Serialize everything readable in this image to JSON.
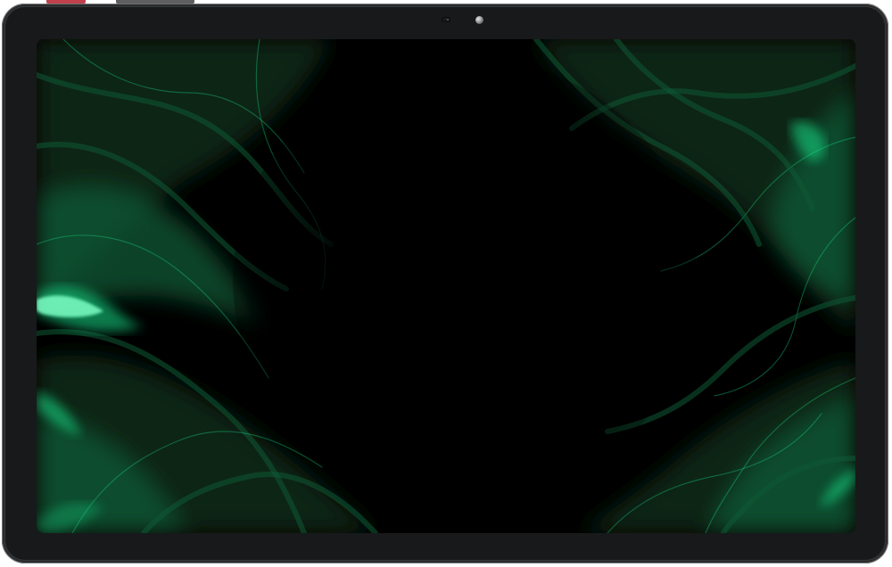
{
  "device": {
    "body_color": "#2a2b2d",
    "bezel_color": "#18191a",
    "power_button_color": "#c0404c",
    "volume_button_color": "#5e5e60"
  },
  "wallpaper": {
    "style": "abstract fluid marble waves",
    "base_color": "#000000",
    "deep_green": "#0a2a19",
    "mid_green": "#0f5a34",
    "glow_green": "#19e08a"
  }
}
